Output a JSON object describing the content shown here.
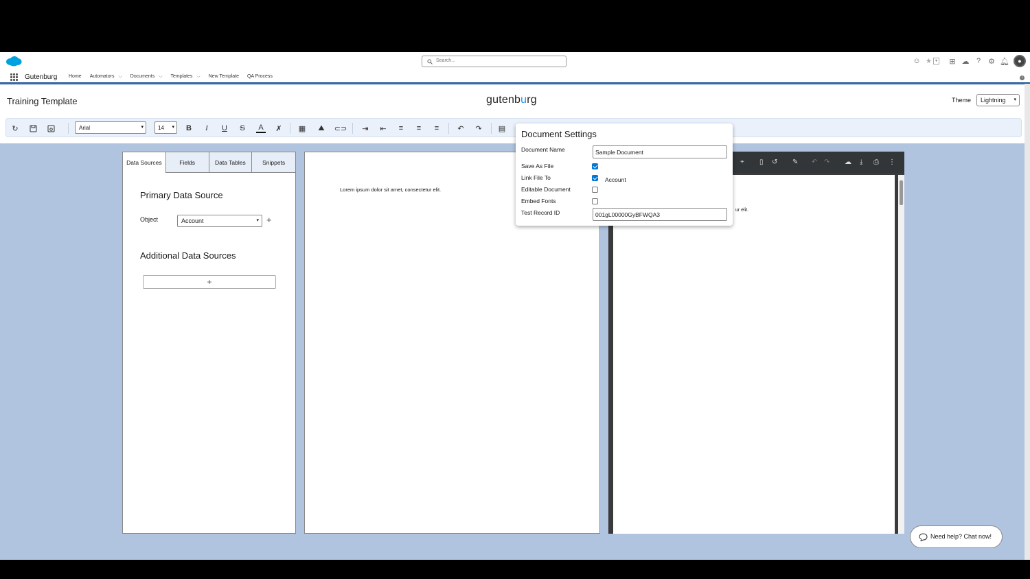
{
  "header": {
    "search_placeholder": "Search...",
    "icons": [
      "einstein-icon",
      "favorites-star-icon",
      "add-icon",
      "trailhead-icon",
      "help-icon",
      "setup-gear-icon",
      "notifications-bell-icon",
      "avatar"
    ]
  },
  "nav": {
    "app_name": "Gutenburg",
    "items": [
      {
        "label": "Home",
        "has_menu": false
      },
      {
        "label": "Automators",
        "has_menu": true
      },
      {
        "label": "Documents",
        "has_menu": true
      },
      {
        "label": "Templates",
        "has_menu": true
      },
      {
        "label": "New Template",
        "has_menu": false
      },
      {
        "label": "QA Process",
        "has_menu": false
      }
    ]
  },
  "page": {
    "title": "Training Template",
    "logo_prefix": "gutenb",
    "logo_accent": "u",
    "logo_suffix": "rg",
    "theme_label": "Theme",
    "theme_value": "Lightning"
  },
  "toolbar": {
    "font_family": "Arial",
    "font_size": "14",
    "bold": "B",
    "italic": "I",
    "underline": "U"
  },
  "left_panel": {
    "tabs": [
      "Data Sources",
      "Fields",
      "Data Tables",
      "Snippets"
    ],
    "active_tab": "Data Sources",
    "primary_title": "Primary Data Source",
    "object_label": "Object",
    "object_value": "Account",
    "additional_title": "Additional Data Sources",
    "add_symbol": "+"
  },
  "editor": {
    "text": "Lorem ipsum dolor sit amet, consectetur elit."
  },
  "pdf": {
    "visible_text": "ur elit."
  },
  "settings": {
    "title": "Document Settings",
    "document_name_label": "Document Name",
    "document_name_value": "Sample Document",
    "save_as_file_label": "Save As File",
    "save_as_file": true,
    "link_file_to_label": "Link File To",
    "link_file_to": true,
    "link_file_to_value": "Account",
    "editable_document_label": "Editable Document",
    "editable_document": false,
    "embed_fonts_label": "Embed Fonts",
    "embed_fonts": false,
    "test_record_label": "Test Record ID",
    "test_record_value": "001gL00000GyBFWQA3"
  },
  "chat": {
    "label": "Need help? Chat now!"
  },
  "colors": {
    "brand_blue": "#0176d3",
    "nav_border": "#1b5297",
    "background": "#b0c4df",
    "logo_accent": "#1b96ff"
  }
}
